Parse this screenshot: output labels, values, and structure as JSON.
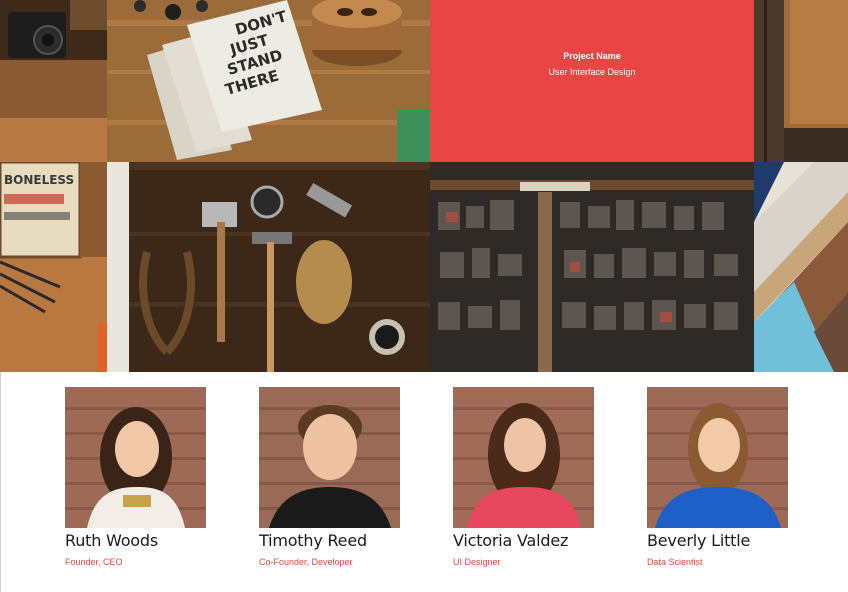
{
  "portfolio": {
    "tiles": [
      {
        "name": "camera-desk"
      },
      {
        "name": "notebooks-dont-just-stand-there",
        "notebook_text": "DON'T JUST STAND THERE"
      },
      {
        "name": "project-overlay",
        "project_name": "Project Name",
        "project_category": "User Interface Design"
      },
      {
        "name": "wood-panel"
      },
      {
        "name": "boneless-sign",
        "sign_text": "BONELESS"
      },
      {
        "name": "tools-flatlay"
      },
      {
        "name": "letterpress-type"
      },
      {
        "name": "colored-wood-planks"
      }
    ],
    "accent_color": "#e84545"
  },
  "team": {
    "members": [
      {
        "name": "Ruth Woods",
        "role": "Founder, CEO"
      },
      {
        "name": "Timothy Reed",
        "role": "Co-Founder, Developer"
      },
      {
        "name": "Victoria Valdez",
        "role": "UI Designer"
      },
      {
        "name": "Beverly Little",
        "role": "Data Scientist"
      }
    ]
  }
}
